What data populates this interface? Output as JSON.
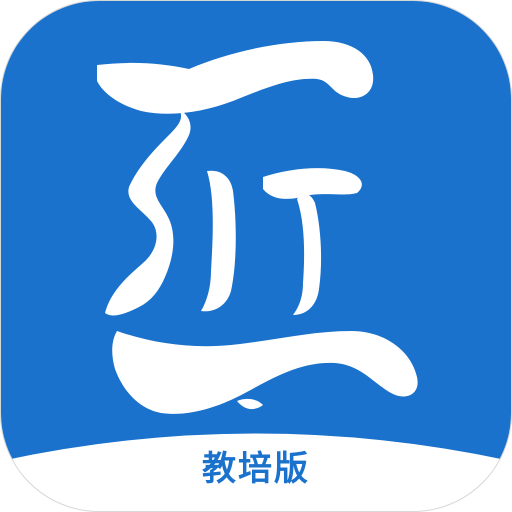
{
  "app_icon": {
    "label": "教培版",
    "glyph_icon": "calligraphy-brush-glyph-icon",
    "colors": {
      "primary_blue": "#1a72cc",
      "glyph_white": "#ffffff",
      "frame_border": "#d7d7d7",
      "label_blue": "#1a72cc"
    }
  }
}
